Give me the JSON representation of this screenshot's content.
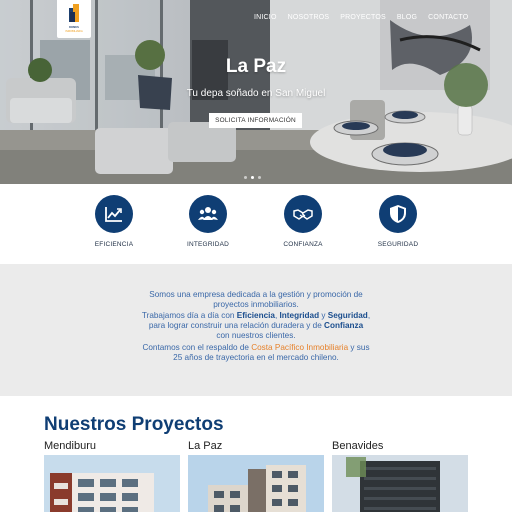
{
  "header": {
    "logo": {
      "line1": "DOMUS",
      "line2": "INMOBILIARIA"
    },
    "nav": [
      "INICIO",
      "NOSOTROS",
      "PROYECTOS",
      "BLOG",
      "CONTACTO"
    ]
  },
  "hero": {
    "title": "La Paz",
    "subtitle": "Tu depa soñado en San Miguel",
    "button": "SOLICITA INFORMACIÓN",
    "slides": 3,
    "active_slide": 1
  },
  "features": [
    {
      "label": "EFICIENCIA",
      "icon": "chart-growth-icon"
    },
    {
      "label": "INTEGRIDAD",
      "icon": "team-icon"
    },
    {
      "label": "CONFIANZA",
      "icon": "handshake-icon"
    },
    {
      "label": "SEGURIDAD",
      "icon": "shield-icon"
    }
  ],
  "about": {
    "p1_l1": "Somos una empresa dedicada a la gestión y promoción de",
    "p1_l2": "proyectos inmobiliarios.",
    "p1_l3a": "Trabajamos día a día con ",
    "p1_l3b": "Eficiencia",
    "p1_l3c": ", ",
    "p1_l3d": "Integridad",
    "p1_l3e": " y ",
    "p1_l3f": "Seguridad",
    "p1_l3g": ",",
    "p1_l4a": "para lograr construir una relación duradera y de ",
    "p1_l4b": "Confianza",
    "p1_l5": "con nuestros clientes.",
    "p2_l1a": "Contamos con el respaldo de ",
    "p2_l1b": "Costa Pacífico Inmobiliaria",
    "p2_l1c": " y sus",
    "p2_l2": "25 años de trayectoria en el mercado chileno."
  },
  "projects": {
    "title": "Nuestros Proyectos",
    "items": [
      {
        "name": "Mendiburu"
      },
      {
        "name": "La Paz"
      },
      {
        "name": "Benavides"
      }
    ]
  },
  "colors": {
    "primary": "#0f3e74",
    "accent": "#e6812a",
    "about_bg": "#ebebeb",
    "about_text": "#3a68a8"
  }
}
